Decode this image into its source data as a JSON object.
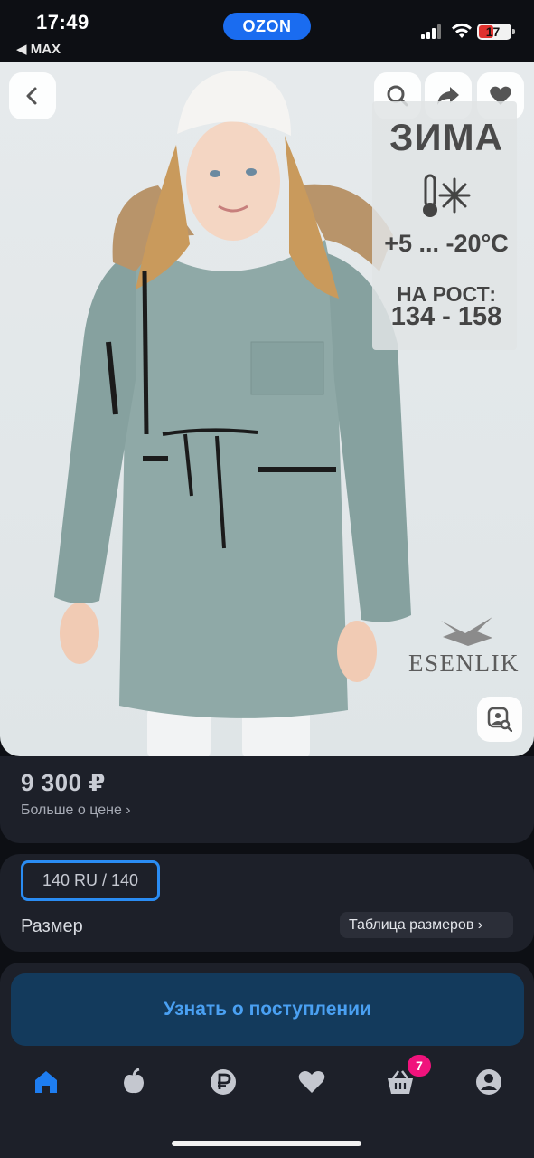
{
  "status_bar": {
    "time": "17:49",
    "back_app": "◀ MAX",
    "app_logo": "OZON",
    "battery": "17"
  },
  "photo": {
    "promo_title": "ЗИМА",
    "promo_temperature": "+5 ... -20°C",
    "promo_height_label": "НА РОСТ:",
    "promo_height_range": "134 - 158",
    "brand": "ESENLIK",
    "icons": [
      "back-arrow-icon",
      "search-icon",
      "share-icon",
      "heart-icon",
      "visual-search-icon"
    ]
  },
  "price": {
    "value": "9 300 ₽",
    "more": "Больше о цене ›"
  },
  "size": {
    "selected": "140 RU / 140",
    "label": "Размер",
    "table_link": "Таблица размеров ›"
  },
  "cta": {
    "label": "Узнать о поступлении"
  },
  "tab_bar": {
    "items": [
      "home",
      "fresh",
      "finance",
      "favorites",
      "cart",
      "profile"
    ],
    "cart_badge": "7",
    "accent": "#1e7df0",
    "inactive": "#c4c7cf"
  },
  "colors": {
    "background": "#0d0f14",
    "card": "#1d2029",
    "cta_bg": "#133a5c",
    "cta_text": "#4aa0f2",
    "badge": "#f0137c"
  }
}
